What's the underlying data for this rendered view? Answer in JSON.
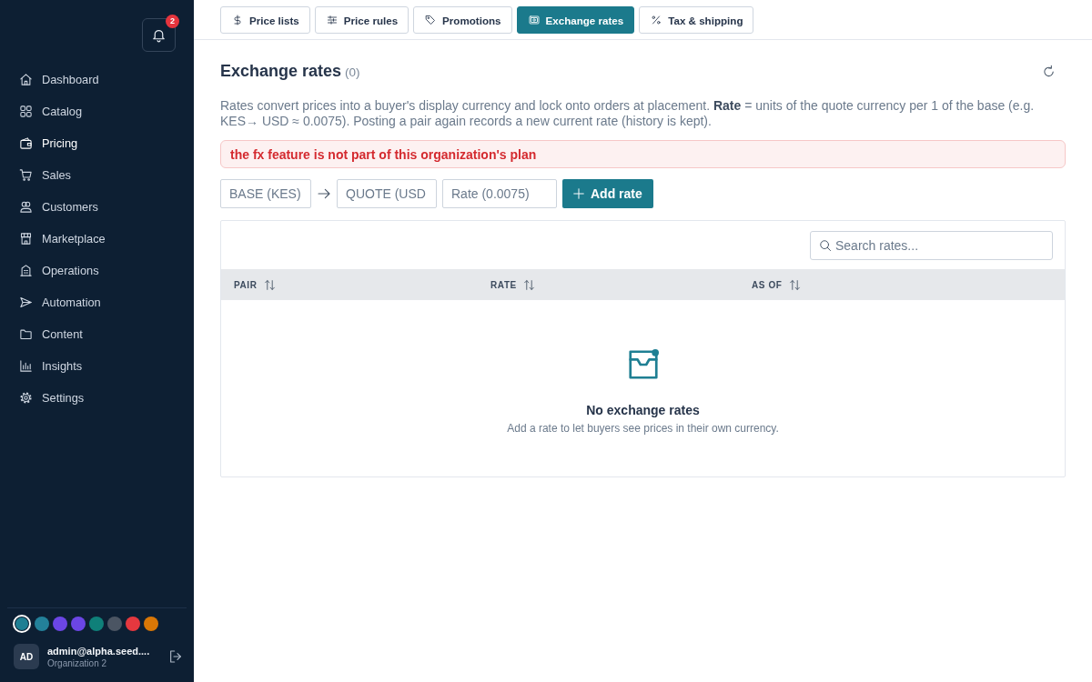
{
  "sidebar": {
    "notifications": {
      "count": "2"
    },
    "nav": [
      {
        "label": "Dashboard",
        "selected": false
      },
      {
        "label": "Catalog",
        "selected": false
      },
      {
        "label": "Pricing",
        "selected": true
      },
      {
        "label": "Sales",
        "selected": false
      },
      {
        "label": "Customers",
        "selected": false
      },
      {
        "label": "Marketplace",
        "selected": false
      },
      {
        "label": "Operations",
        "selected": false
      },
      {
        "label": "Automation",
        "selected": false
      },
      {
        "label": "Content",
        "selected": false
      },
      {
        "label": "Insights",
        "selected": false
      },
      {
        "label": "Settings",
        "selected": false
      }
    ],
    "color_swatches": [
      {
        "color": "#1f7f93",
        "selected": true
      },
      {
        "color": "#23819a",
        "selected": false
      },
      {
        "color": "#6b46e5",
        "selected": false
      },
      {
        "color": "#6b46e5",
        "selected": false
      },
      {
        "color": "#0f8079",
        "selected": false
      },
      {
        "color": "#4b5563",
        "selected": false
      },
      {
        "color": "#e5383f",
        "selected": false
      },
      {
        "color": "#d97706",
        "selected": false
      }
    ],
    "user": {
      "initials": "AD",
      "email": "admin@alpha.seed....",
      "organization": "Organization 2"
    }
  },
  "tabs": [
    {
      "label": "Price lists",
      "selected": false
    },
    {
      "label": "Price rules",
      "selected": false
    },
    {
      "label": "Promotions",
      "selected": false
    },
    {
      "label": "Exchange rates",
      "selected": true
    },
    {
      "label": "Tax & shipping",
      "selected": false
    }
  ],
  "header": {
    "title": "Exchange rates",
    "count": "(0)"
  },
  "description": "Rates convert prices into a buyer's display currency and lock onto orders at placement. **Rate** = units of the quote currency per 1 of the base (e.g. KES→ USD ≈ 0.0075). Posting a pair again records a new current rate (history is kept).",
  "error": "the fx feature is not part of this organization's plan",
  "add_form": {
    "fields": [
      {
        "placeholder": "BASE (KES)"
      },
      {
        "placeholder": "QUOTE (USD"
      },
      {
        "placeholder": "Rate (0.0075)"
      }
    ],
    "button": "Add rate"
  },
  "table": {
    "search": {
      "placeholder": "Search rates..."
    },
    "columns": [
      {
        "label": "PAIR"
      },
      {
        "label": "RATE"
      },
      {
        "label": "AS OF"
      }
    ],
    "empty_state": {
      "title": "No exchange rates",
      "message": "Add a rate to let buyers see prices in their own currency."
    }
  }
}
